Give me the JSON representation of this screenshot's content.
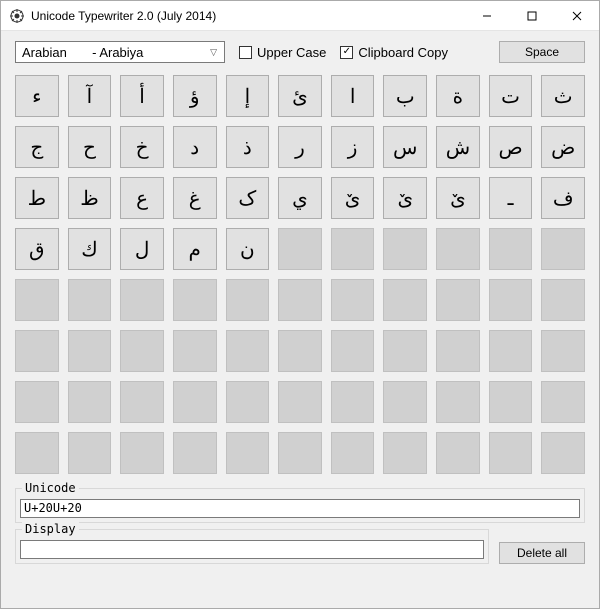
{
  "window": {
    "title": "Unicode Typewriter 2.0 (July 2014)"
  },
  "toolbar": {
    "language_selected": "Arabian       - Arabiya",
    "uppercase_label": "Upper Case",
    "uppercase_checked": false,
    "clipboard_label": "Clipboard Copy",
    "clipboard_checked": true,
    "space_label": "Space"
  },
  "keys": [
    "ء",
    "آ",
    "أ",
    "ؤ",
    "إ",
    "ئ",
    "ا",
    "ب",
    "ة",
    "ت",
    "ث",
    "ج",
    "ح",
    "خ",
    "د",
    "ذ",
    "ر",
    "ز",
    "س",
    "ش",
    "ص",
    "ض",
    "ط",
    "ظ",
    "ع",
    "غ",
    "ک",
    "ي",
    "ێ",
    "ێ",
    "ێ",
    "ـ",
    "ف",
    "ق",
    "ك",
    "ل",
    "م",
    "ن"
  ],
  "grid_total": 88,
  "unicode_field": {
    "label": "Unicode",
    "value": "U+20U+20"
  },
  "display_field": {
    "label": "Display",
    "value": ""
  },
  "delete_label": "Delete all"
}
